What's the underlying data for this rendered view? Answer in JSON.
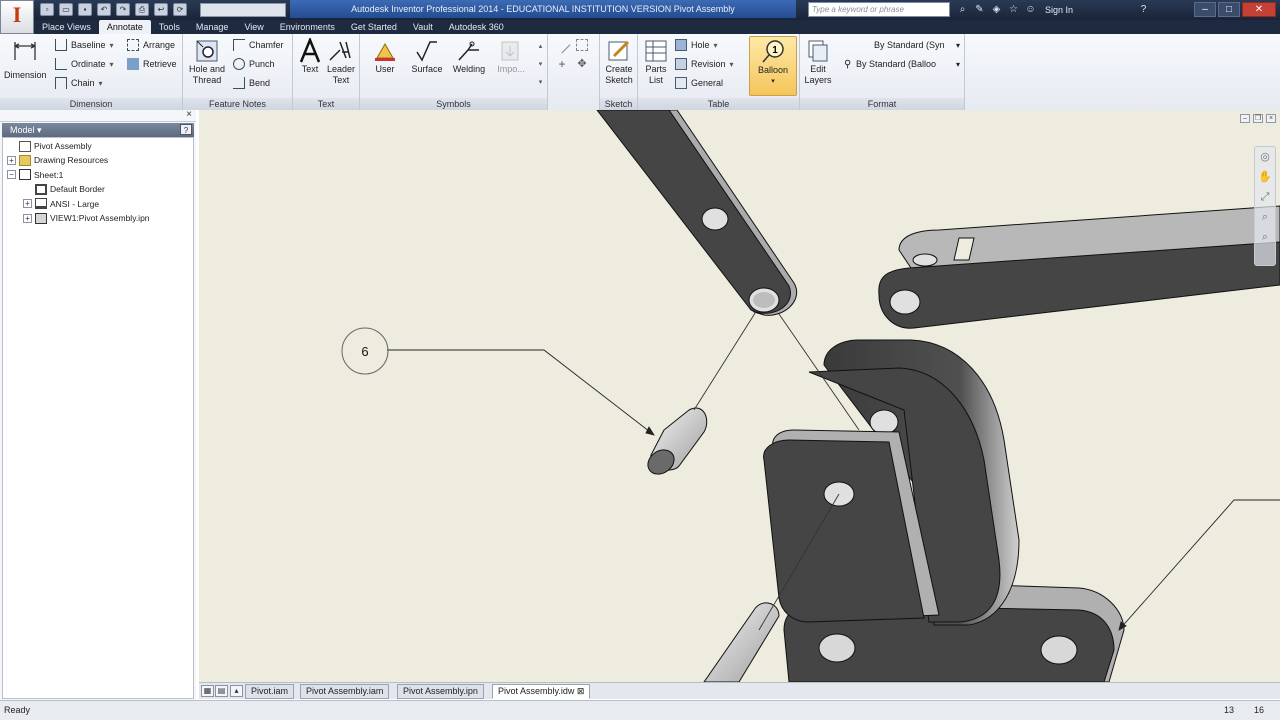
{
  "app": {
    "logo_letter": "I",
    "window_title": "Autodesk Inventor Professional 2014 - EDUCATIONAL INSTITUTION VERSION    Pivot Assembly",
    "search_placeholder": "Type a keyword or phrase",
    "sign_in": "Sign In",
    "quick_access_icons": [
      "new-icon",
      "open-icon",
      "save-icon",
      "undo-icon",
      "redo-icon",
      "print-icon",
      "return-icon",
      "update-icon"
    ]
  },
  "tabs": [
    "Place Views",
    "Annotate",
    "Tools",
    "Manage",
    "View",
    "Environments",
    "Get Started",
    "Vault",
    "Autodesk 360"
  ],
  "active_tab": "Annotate",
  "ribbon": {
    "dimension_panel": {
      "title": "Dimension",
      "big_label": "Dimension",
      "baseline": "Baseline",
      "ordinate": "Ordinate",
      "chain": "Chain",
      "arrange": "Arrange",
      "retrieve": "Retrieve"
    },
    "feature_notes_panel": {
      "title": "Feature Notes",
      "hole_thread_1": "Hole and",
      "hole_thread_2": "Thread",
      "chamfer": "Chamfer",
      "punch": "Punch",
      "bend": "Bend"
    },
    "text_panel": {
      "title": "Text",
      "text": "Text",
      "leader_1": "Leader",
      "leader_2": "Text"
    },
    "symbols_panel": {
      "title": "Symbols",
      "user": "User",
      "surface": "Surface",
      "welding": "Welding",
      "import": "Impo..."
    },
    "sketch_panel": {
      "title": "Sketch",
      "create_1": "Create",
      "create_2": "Sketch"
    },
    "table_panel": {
      "title": "Table",
      "parts_1": "Parts",
      "parts_2": "List",
      "hole": "Hole",
      "revision": "Revision",
      "general": "General",
      "balloon": "Balloon"
    },
    "format_panel": {
      "title": "Format",
      "edit_1": "Edit",
      "edit_2": "Layers",
      "style_1": "By Standard (Syn",
      "style_2": "By Standard (Balloo"
    }
  },
  "browser": {
    "header": "Model ▾",
    "tree": [
      {
        "label": "Pivot Assembly",
        "icon": "drawing-icon",
        "level": 0,
        "toggle": ""
      },
      {
        "label": "Drawing Resources",
        "icon": "folder-icon",
        "level": 0,
        "toggle": "+"
      },
      {
        "label": "Sheet:1",
        "icon": "sheet-icon",
        "level": 0,
        "toggle": "−"
      },
      {
        "label": "Default Border",
        "icon": "border-icon",
        "level": 1,
        "toggle": ""
      },
      {
        "label": "ANSI - Large",
        "icon": "titleblock-icon",
        "level": 1,
        "toggle": "+"
      },
      {
        "label": "VIEW1:Pivot Assembly.ipn",
        "icon": "view-icon",
        "level": 1,
        "toggle": "+"
      }
    ]
  },
  "canvas": {
    "balloon_text": "6"
  },
  "doc_tabs": [
    "Pivot.iam",
    "Pivot Assembly.iam",
    "Pivot Assembly.ipn",
    "Pivot Assembly.idw"
  ],
  "active_doc": "Pivot Assembly.idw",
  "status": {
    "text": "Ready",
    "num1": "13",
    "num2": "16"
  },
  "colors": {
    "canvas_bg": "#eeecde",
    "part_dark": "#454545",
    "part_light": "#c8c8c8",
    "title_active": "#2c5aa0",
    "balloon_selected": "#f5c55a"
  }
}
